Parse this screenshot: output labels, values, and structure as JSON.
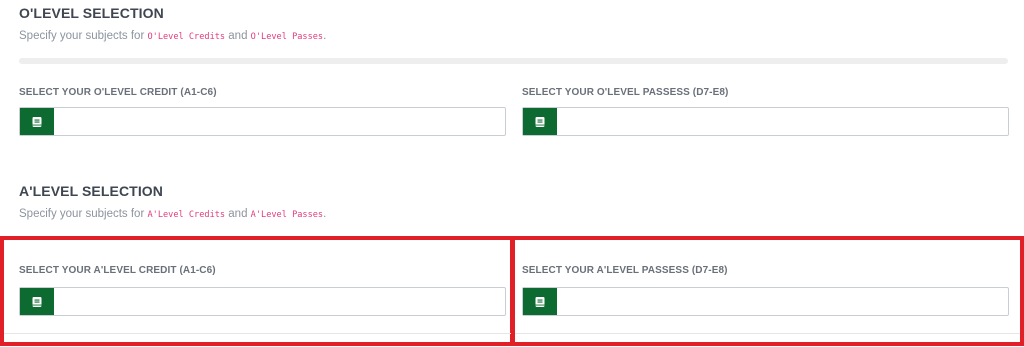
{
  "olevel": {
    "title": "O'LEVEL SELECTION",
    "desc_prefix": "Specify your subjects for ",
    "desc_code1": "O'Level Credits",
    "desc_and": " and ",
    "desc_code2": "O'Level Passes",
    "desc_suffix": ".",
    "credit_label": "SELECT YOUR O'LEVEL CREDIT (A1-C6)",
    "credit_value": "",
    "passes_label": "SELECT YOUR O'LEVEL PASSESS (D7-E8)",
    "passes_value": ""
  },
  "alevel": {
    "title": "A'LEVEL SELECTION",
    "desc_prefix": "Specify your subjects for ",
    "desc_code1": "A'Level Credits",
    "desc_and": " and ",
    "desc_code2": "A'Level Passes",
    "desc_suffix": ".",
    "credit_label": "SELECT YOUR A'LEVEL CREDIT (A1-C6)",
    "credit_value": "",
    "passes_label": "SELECT YOUR A'LEVEL PASSESS (D7-E8)",
    "passes_value": ""
  },
  "icons": {
    "field_addon": "book-icon"
  },
  "colors": {
    "accent_green": "#0d6b31",
    "code_pink": "#e23b7d",
    "highlight_red": "#e01f26"
  }
}
